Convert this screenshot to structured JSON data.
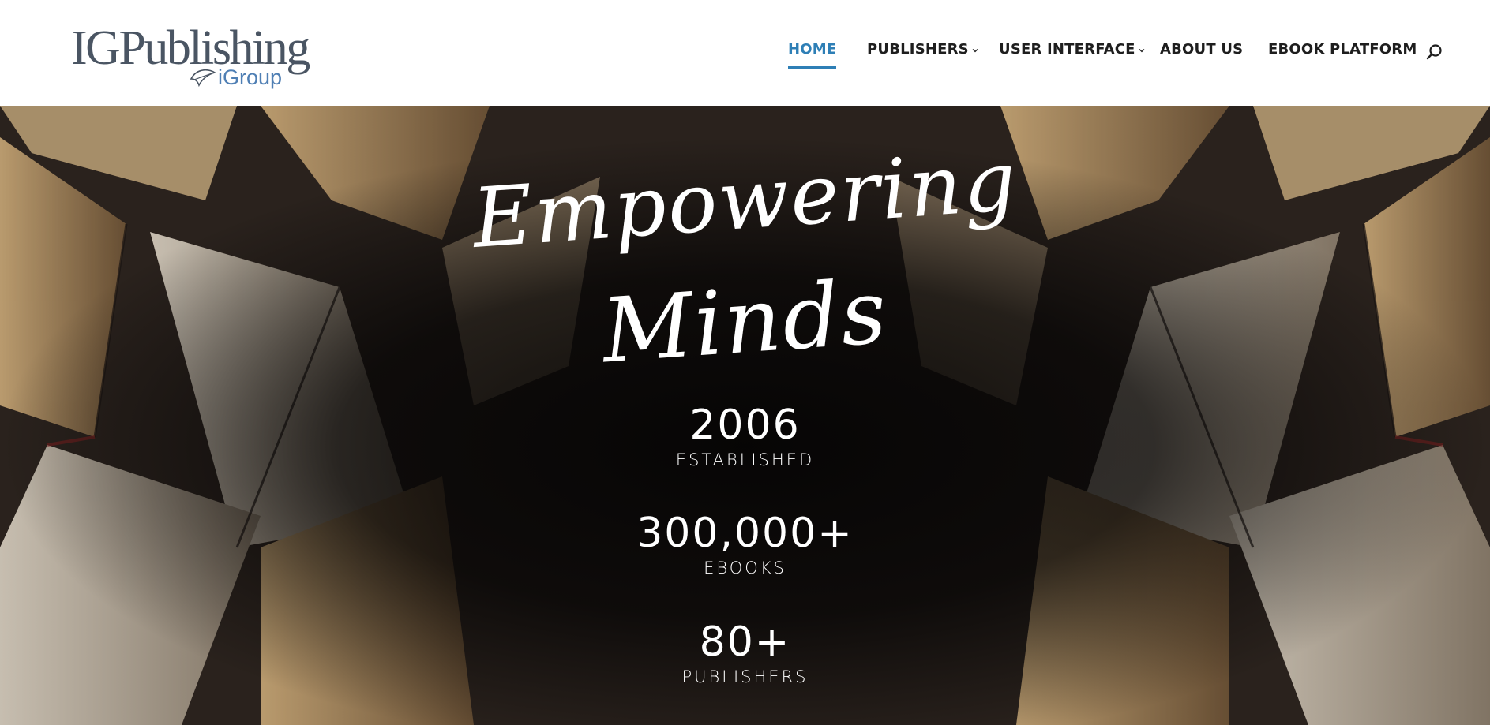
{
  "brand": {
    "logo_main": "IGPublishing",
    "logo_sub": "iGroup",
    "primary_color": "#2e7fb6",
    "logo_text_color": "#4a5563",
    "logo_sub_color": "#4f7fb4"
  },
  "nav": {
    "items": [
      {
        "label": "HOME",
        "active": true,
        "has_dropdown": false
      },
      {
        "label": "PUBLISHERS",
        "active": false,
        "has_dropdown": true
      },
      {
        "label": "USER INTERFACE",
        "active": false,
        "has_dropdown": true
      },
      {
        "label": "ABOUT US",
        "active": false,
        "has_dropdown": false
      },
      {
        "label": "EBOOK PLATFORM",
        "active": false,
        "has_dropdown": false
      }
    ],
    "search_icon": "search-icon"
  },
  "hero": {
    "headline_line1": "Empowering",
    "headline_line2": "Minds",
    "stats": [
      {
        "value": "2006",
        "label": "ESTABLISHED"
      },
      {
        "value": "300,000+",
        "label": "EBOOKS"
      },
      {
        "value": "80+",
        "label": "PUBLISHERS"
      }
    ]
  }
}
